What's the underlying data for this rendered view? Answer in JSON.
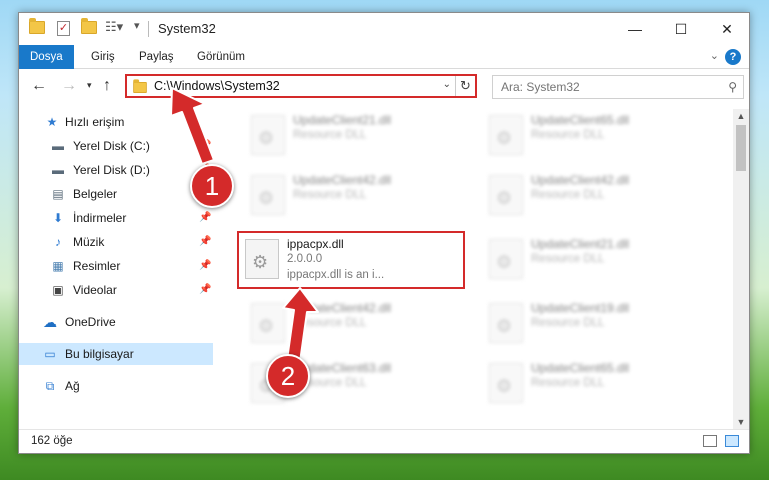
{
  "window": {
    "title": "System32",
    "controls": {
      "minimize": "—",
      "maximize": "☐",
      "close": "✕"
    }
  },
  "ribbon": {
    "tabs": [
      "Dosya",
      "Giriş",
      "Paylaş",
      "Görünüm"
    ],
    "help": "?"
  },
  "address": {
    "path": "C:\\Windows\\System32",
    "search_placeholder": "Ara: System32"
  },
  "sidebar": {
    "items": [
      {
        "label": "Hızlı erişim",
        "icon": "star-icon"
      },
      {
        "label": "Yerel Disk (C:)",
        "icon": "drive-icon"
      },
      {
        "label": "Yerel Disk (D:)",
        "icon": "drive-icon"
      },
      {
        "label": "Belgeler",
        "icon": "documents-icon"
      },
      {
        "label": "İndirmeler",
        "icon": "download-icon"
      },
      {
        "label": "Müzik",
        "icon": "music-icon"
      },
      {
        "label": "Resimler",
        "icon": "pictures-icon"
      },
      {
        "label": "Videolar",
        "icon": "video-icon"
      },
      {
        "label": "OneDrive",
        "icon": "cloud-icon"
      },
      {
        "label": "Bu bilgisayar",
        "icon": "computer-icon"
      },
      {
        "label": "Ağ",
        "icon": "network-icon"
      }
    ]
  },
  "files": {
    "left": [
      {
        "name": "UpdateClient21.dll",
        "type": "Resource DLL"
      },
      {
        "name": "UpdateClient42.dll",
        "type": "Resource DLL"
      },
      {
        "name": "ippacpx.dll",
        "version": "2.0.0.0",
        "desc": "ippacpx.dll is an i..."
      },
      {
        "name": "UpdateClient42.dll",
        "type": "Resource DLL"
      },
      {
        "name": "UpdateClient63.dll",
        "type": "Resource DLL"
      }
    ],
    "right": [
      {
        "name": "UpdateClient65.dll",
        "type": "Resource DLL"
      },
      {
        "name": "UpdateClient42.dll",
        "type": "Resource DLL"
      },
      {
        "name": "UpdateClient21.dll",
        "type": "Resource DLL"
      },
      {
        "name": "UpdateClient19.dll",
        "type": "Resource DLL"
      },
      {
        "name": "UpdateClient65.dll",
        "type": "Resource DLL"
      }
    ]
  },
  "status": {
    "count": "162 öğe"
  },
  "annotations": {
    "callout1": "1",
    "callout2": "2"
  },
  "colors": {
    "accent": "#1979ca",
    "annotation": "#d42a2a"
  }
}
